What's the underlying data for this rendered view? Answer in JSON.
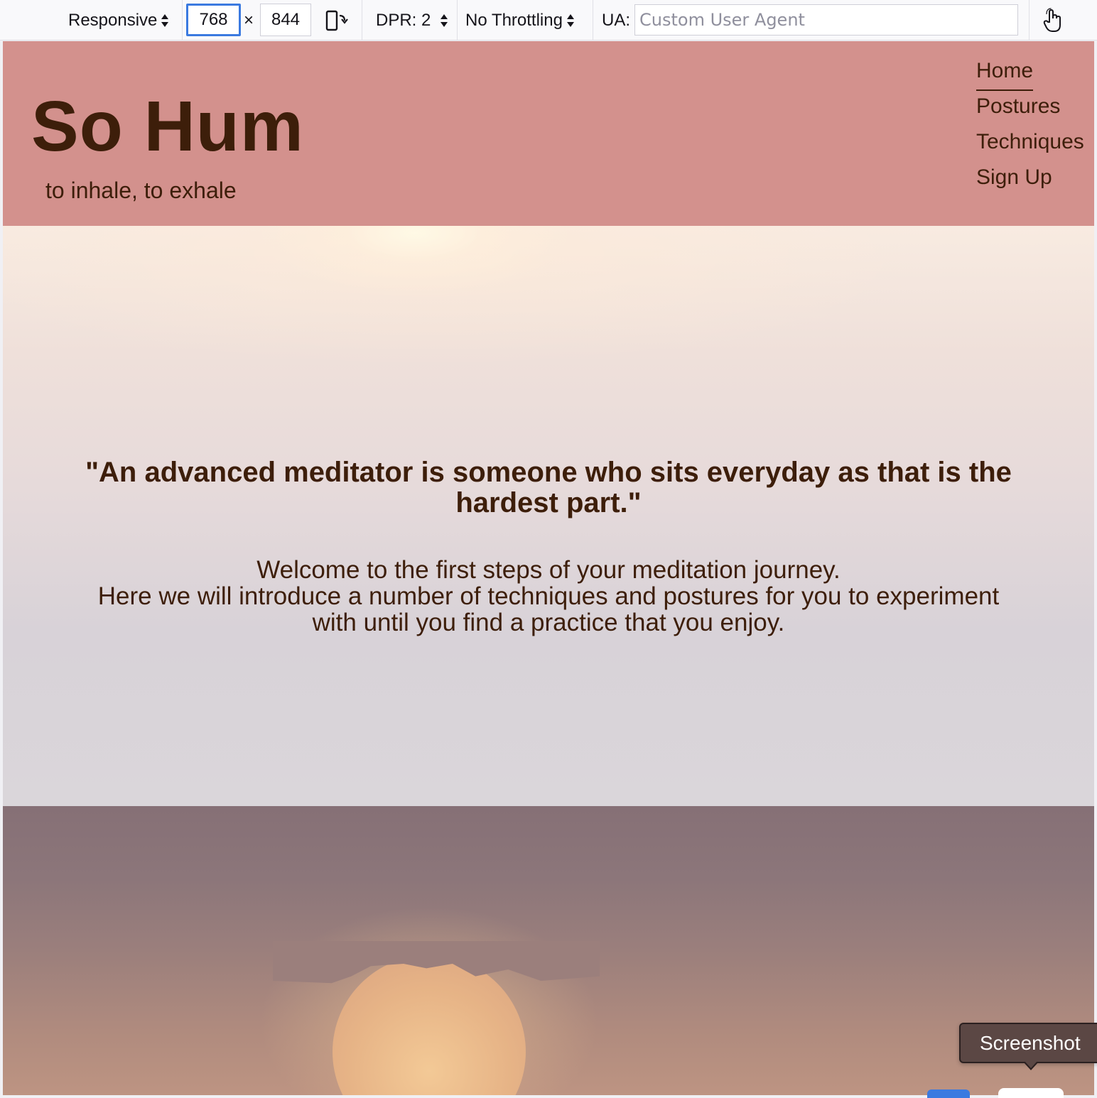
{
  "toolbar": {
    "device_label": "Responsive",
    "width_value": "768",
    "times_symbol": "×",
    "height_value": "844",
    "dpr_label": "DPR: 2",
    "throttling_label": "No Throttling",
    "ua_label": "UA:",
    "ua_placeholder": "Custom User Agent"
  },
  "site": {
    "title": "So Hum",
    "tagline": "to inhale, to exhale",
    "nav": [
      "Home",
      "Postures",
      "Techniques",
      "Sign Up"
    ],
    "active_nav": "Home",
    "quote": "\"An advanced meditator is someone who sits everyday as that is the hardest part.\"",
    "intro_line1": "Welcome to the first steps of your meditation journey.",
    "intro_line2": "Here we will introduce a number of techniques and postures for you to experiment with until you find a practice that you enjoy."
  },
  "tooltip": {
    "label": "Screenshot"
  },
  "colors": {
    "header_bg": "#d3918d",
    "text_brown": "#3d1e0a",
    "focus_blue": "#3b7ae0",
    "tooltip_bg": "#5b4744"
  },
  "icons": {
    "rotate": "rotate-device-icon",
    "touch": "touch-simulation-icon"
  }
}
